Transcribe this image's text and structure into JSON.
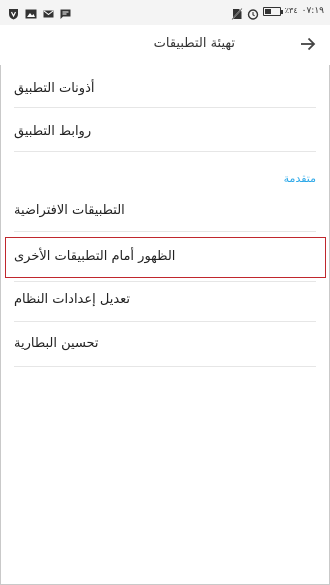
{
  "status_bar": {
    "time": "٠٧:١٩",
    "battery_percent_text": "٪٣٤",
    "battery_level": 0.34,
    "left_icons": [
      "shield-icon",
      "image-icon",
      "mail-icon",
      "message-icon"
    ],
    "right_icons": [
      "no-sim-icon",
      "alarm-icon",
      "battery-icon"
    ]
  },
  "app_bar": {
    "title": "تهيئة التطبيقات"
  },
  "items": [
    {
      "id": "permissions",
      "label": "أذونات التطبيق"
    },
    {
      "id": "links",
      "label": "روابط التطبيق"
    }
  ],
  "advanced_section": {
    "header": "متقدمة",
    "items": [
      {
        "id": "default-apps",
        "label": "التطبيقات الافتراضية"
      },
      {
        "id": "draw-over-apps",
        "label": "الظهور أمام التطبيقات الأخرى",
        "highlighted": true
      },
      {
        "id": "modify-system-settings",
        "label": "تعديل إعدادات النظام"
      },
      {
        "id": "battery-optimization",
        "label": "تحسين البطارية"
      }
    ]
  },
  "colors": {
    "accent": "#2aa7e8",
    "highlight_border": "#c0272d",
    "text": "#222222"
  }
}
